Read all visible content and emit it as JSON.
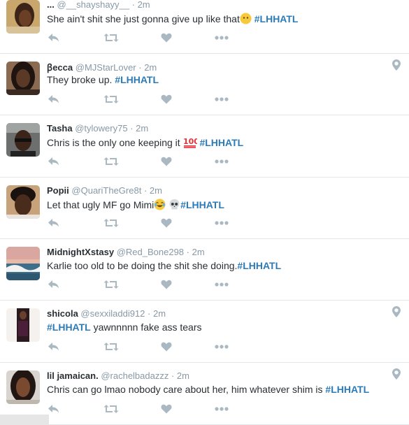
{
  "colors": {
    "name": "#292f33",
    "meta": "#8899a6",
    "hashtag": "#2b7bb9",
    "action": "#aab8c2",
    "divider": "#e1e8ed"
  },
  "tweets": [
    {
      "name": "...",
      "handle": "@__shayshayy__",
      "time": "· 2m",
      "text": "She ain't shit she just gonna give up like that",
      "emoji": "no-mouth-face",
      "text_after": "",
      "tag": "#LHHATL",
      "geo": false
    },
    {
      "name": "ꞵecca",
      "handle": "@MJStarLover",
      "time": "· 2m",
      "text": "They broke up. ",
      "emoji": "",
      "text_after": "",
      "tag": "#LHHATL",
      "geo": true
    },
    {
      "name": "Tasha",
      "handle": "@tylowery75",
      "time": "· 2m",
      "text": "Chris is the only one keeping it ",
      "emoji": "hundred-points",
      "text_after": " ",
      "tag": "#LHHATL",
      "geo": false
    },
    {
      "name": "Popii",
      "handle": "@QuariTheGre8t",
      "time": "· 2m",
      "text": "Let that ugly MF go Mimi",
      "emoji": "laughing-skull",
      "text_after": "",
      "tag": "#LHHATL",
      "geo": false
    },
    {
      "name": "MidnightXstasy",
      "handle": "@Red_Bone298",
      "time": "· 2m",
      "text": "Karlie too old to be doing the shit she doing.",
      "emoji": "",
      "text_after": "",
      "tag": "#LHHATL",
      "geo": false
    },
    {
      "name": "shicola",
      "handle": "@sexxiladdi912",
      "time": "· 2m",
      "tag_first": "#LHHATL",
      "text_rest": " yawnnnnn fake ass tears",
      "geo": true
    },
    {
      "name": "lil jamaican.",
      "handle": "@rachelbadazzz",
      "time": "· 2m",
      "text": "Chris can go lmao nobody care about her, him whatever shim is ",
      "emoji": "",
      "text_after": "",
      "tag": "#LHHATL",
      "geo": true
    }
  ],
  "actions": {
    "reply": "reply-icon",
    "retweet": "retweet-icon",
    "like": "heart-icon",
    "more": "more-icon"
  }
}
